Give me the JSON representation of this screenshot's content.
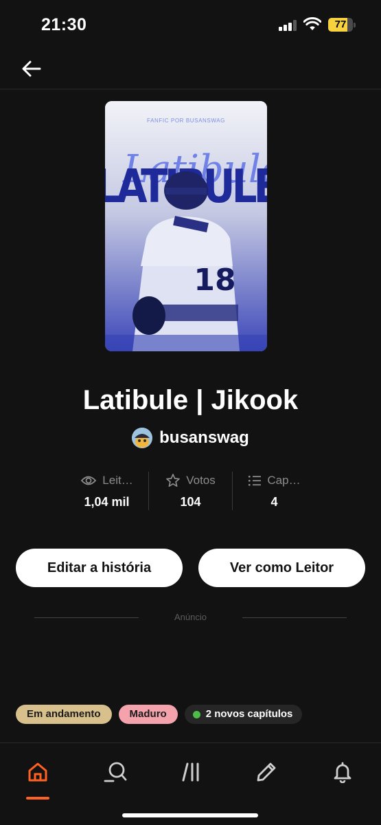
{
  "status_bar": {
    "time": "21:30",
    "battery": "77",
    "battery_level": 0.77
  },
  "cover": {
    "credit": "FANFIC POR BUSANSWAG",
    "title_text": "LATIBULE",
    "script_text": "Latibule",
    "jersey_number": "18"
  },
  "story": {
    "title": "Latibule | Jikook",
    "author": "busanswag"
  },
  "stats": [
    {
      "label": "Leit…",
      "value": "1,04 mil",
      "icon": "eye-icon"
    },
    {
      "label": "Votos",
      "value": "104",
      "icon": "star-icon"
    },
    {
      "label": "Cap…",
      "value": "4",
      "icon": "list-icon"
    }
  ],
  "actions": {
    "edit": "Editar a história",
    "read": "Ver como Leitor"
  },
  "ad": {
    "label": "Anúncio"
  },
  "tags": {
    "status": "Em andamento",
    "mature": "Maduro",
    "new_chapters": "2 novos capítulos"
  },
  "colors": {
    "accent": "#ff6122",
    "status_tag": "#d8c08d",
    "mature_tag": "#f4a3ad",
    "new_dot": "#4dbb47",
    "battery": "#f7d23e"
  },
  "tab_bar": [
    "home-icon",
    "search-icon",
    "library-icon",
    "pencil-icon",
    "bell-icon"
  ]
}
